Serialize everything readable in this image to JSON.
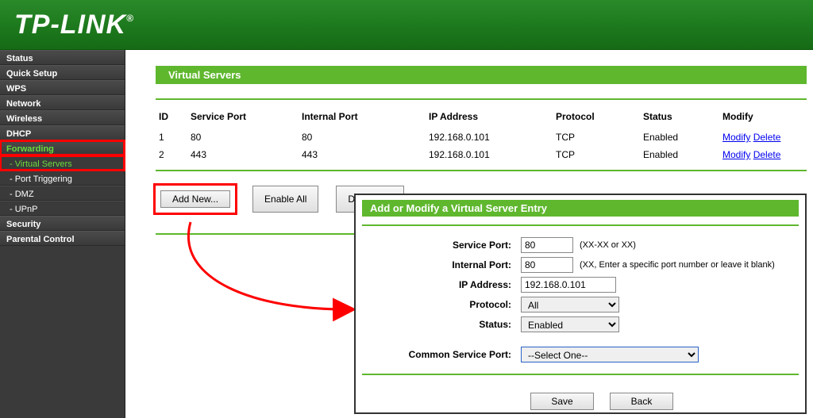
{
  "logo": "TP-LINK",
  "sidebar": {
    "items": [
      {
        "label": "Status",
        "sub": false
      },
      {
        "label": "Quick Setup",
        "sub": false
      },
      {
        "label": "WPS",
        "sub": false
      },
      {
        "label": "Network",
        "sub": false
      },
      {
        "label": "Wireless",
        "sub": false
      },
      {
        "label": "DHCP",
        "sub": false
      },
      {
        "label": "Forwarding",
        "sub": false,
        "active": true,
        "highlight": true
      },
      {
        "label": "- Virtual Servers",
        "sub": true,
        "active": true,
        "highlight": true
      },
      {
        "label": "- Port Triggering",
        "sub": true
      },
      {
        "label": "- DMZ",
        "sub": true
      },
      {
        "label": "- UPnP",
        "sub": true
      },
      {
        "label": "Security",
        "sub": false
      },
      {
        "label": "Parental Control",
        "sub": false
      }
    ]
  },
  "page": {
    "title": "Virtual Servers",
    "columns": [
      "ID",
      "Service Port",
      "Internal Port",
      "IP Address",
      "Protocol",
      "Status",
      "Modify"
    ],
    "rows": [
      {
        "id": "1",
        "service_port": "80",
        "internal_port": "80",
        "ip": "192.168.0.101",
        "protocol": "TCP",
        "status": "Enabled"
      },
      {
        "id": "2",
        "service_port": "443",
        "internal_port": "443",
        "ip": "192.168.0.101",
        "protocol": "TCP",
        "status": "Enabled"
      }
    ],
    "modify_link": "Modify",
    "delete_link": "Delete",
    "buttons": {
      "add": "Add New...",
      "enable": "Enable All",
      "disable": "Disable All"
    }
  },
  "dialog": {
    "title": "Add or Modify a Virtual Server Entry",
    "labels": {
      "service_port": "Service Port:",
      "internal_port": "Internal Port:",
      "ip": "IP Address:",
      "protocol": "Protocol:",
      "status": "Status:",
      "common": "Common Service Port:"
    },
    "values": {
      "service_port": "80",
      "internal_port": "80",
      "ip": "192.168.0.101",
      "protocol": "All",
      "status": "Enabled",
      "common": "--Select One--"
    },
    "hints": {
      "service_port": "(XX-XX or XX)",
      "internal_port": "(XX, Enter a specific port number or leave it blank)"
    },
    "buttons": {
      "save": "Save",
      "back": "Back"
    }
  }
}
